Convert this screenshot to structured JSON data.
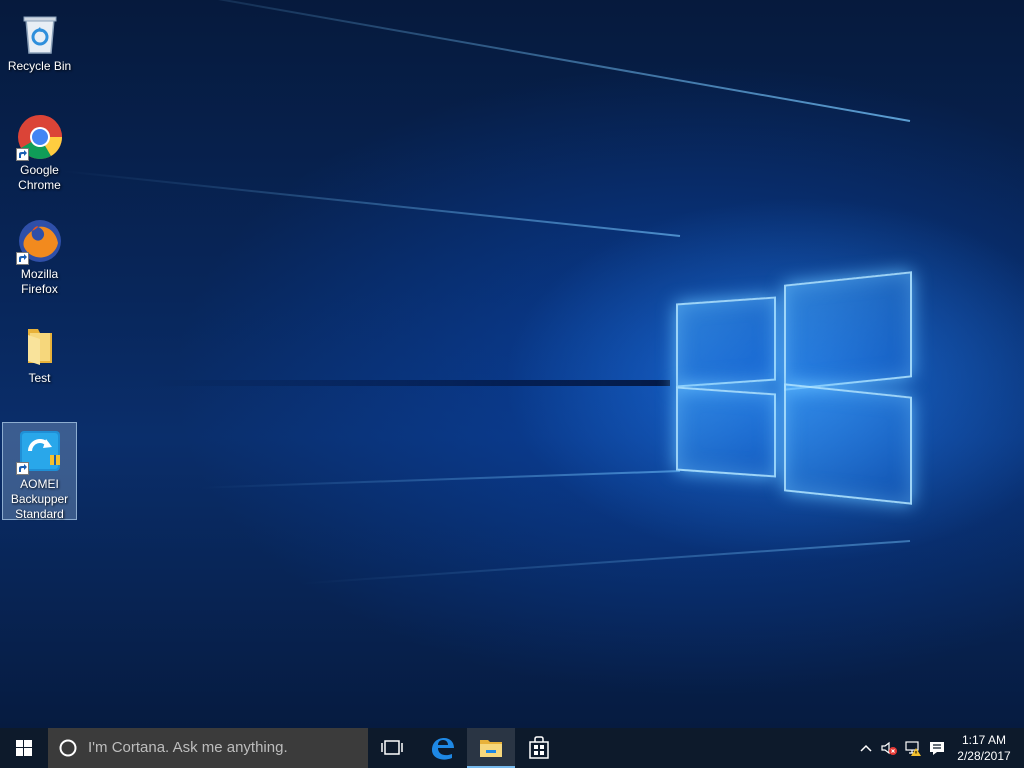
{
  "desktop": {
    "icons": [
      {
        "label": "Recycle Bin",
        "icon": "recycle-bin-icon"
      },
      {
        "label": "Google Chrome",
        "icon": "chrome-icon"
      },
      {
        "label": "Mozilla Firefox",
        "icon": "firefox-icon"
      },
      {
        "label": "Test",
        "icon": "folder-icon"
      },
      {
        "label": "AOMEI Backupper Standard",
        "icon": "aomei-backupper-icon"
      }
    ]
  },
  "taskbar": {
    "search_placeholder": "I'm Cortana. Ask me anything.",
    "pinned": [
      {
        "name": "task-view",
        "icon": "task-view-icon"
      },
      {
        "name": "edge",
        "icon": "edge-icon"
      },
      {
        "name": "file-explorer",
        "icon": "file-explorer-icon"
      },
      {
        "name": "store",
        "icon": "store-icon"
      }
    ],
    "clock": {
      "time": "1:17 AM",
      "date": "2/28/2017"
    }
  },
  "colors": {
    "taskbar_bg": "#0d1a2b",
    "search_bg": "#3b3b3b",
    "accent": "#76b9ed",
    "wallpaper_light": "#2c8cff"
  }
}
